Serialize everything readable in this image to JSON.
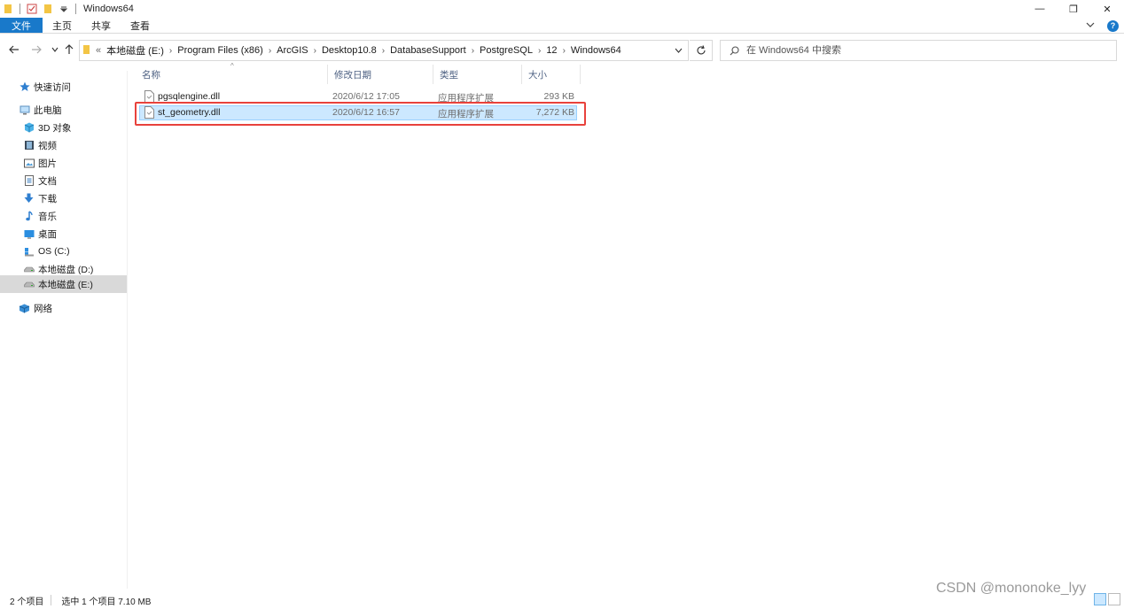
{
  "window": {
    "title": "Windows64",
    "controls": {
      "minimize": "—",
      "maximize": "❐",
      "close": "✕"
    }
  },
  "ribbon": {
    "tabs": [
      "文件",
      "主页",
      "共享",
      "查看"
    ],
    "expand_icon": "chevron-down-icon",
    "help_label": "?"
  },
  "address": {
    "overflow": "«",
    "crumbs": [
      "本地磁盘 (E:)",
      "Program Files (x86)",
      "ArcGIS",
      "Desktop10.8",
      "DatabaseSupport",
      "PostgreSQL",
      "12",
      "Windows64"
    ]
  },
  "search": {
    "placeholder": "在 Windows64 中搜索"
  },
  "sidebar": {
    "items": [
      {
        "label": "快速访问",
        "icon": "star-icon"
      },
      {
        "label": "此电脑",
        "icon": "computer-icon"
      },
      {
        "label": "3D 对象",
        "icon": "cube-icon"
      },
      {
        "label": "视频",
        "icon": "video-icon"
      },
      {
        "label": "图片",
        "icon": "picture-icon"
      },
      {
        "label": "文档",
        "icon": "document-icon"
      },
      {
        "label": "下载",
        "icon": "download-icon"
      },
      {
        "label": "音乐",
        "icon": "music-icon"
      },
      {
        "label": "桌面",
        "icon": "desktop-icon"
      },
      {
        "label": "OS (C:)",
        "icon": "windows-drive-icon"
      },
      {
        "label": "本地磁盘 (D:)",
        "icon": "drive-icon"
      },
      {
        "label": "本地磁盘 (E:)",
        "icon": "drive-icon",
        "selected": true
      },
      {
        "label": "网络",
        "icon": "network-icon"
      }
    ]
  },
  "columns": {
    "name": "名称",
    "date": "修改日期",
    "type": "类型",
    "size": "大小"
  },
  "files": [
    {
      "name": "pgsqlengine.dll",
      "date": "2020/6/12 17:05",
      "type": "应用程序扩展",
      "size": "293 KB",
      "selected": false
    },
    {
      "name": "st_geometry.dll",
      "date": "2020/6/12 16:57",
      "type": "应用程序扩展",
      "size": "7,272 KB",
      "selected": true
    }
  ],
  "status": {
    "count": "2 个项目",
    "selection": "选中 1 个项目  7.10 MB"
  },
  "watermark": "CSDN @mononoke_lyy",
  "colors": {
    "accent": "#1979ca",
    "selection": "#cce8ff",
    "highlight_box": "#e8423c"
  }
}
